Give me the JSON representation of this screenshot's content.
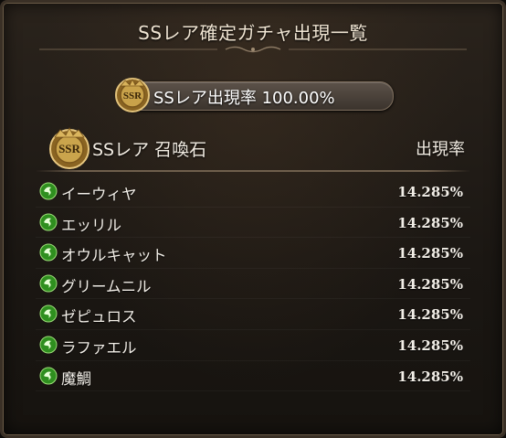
{
  "dialog": {
    "title": "SSレア確定ガチャ出現一覧"
  },
  "banner": {
    "badge_text": "SSR",
    "rate_text": "SSレア出現率 100.00%"
  },
  "header": {
    "badge_text": "SSR",
    "label": "SSレア 召喚石",
    "rate_label": "出現率"
  },
  "colors": {
    "gold": "#c9a24a",
    "wind_icon": "#3fae2a",
    "text": "#f3efe8"
  },
  "items": [
    {
      "name": "イーウィヤ",
      "rate": "14.285%",
      "icon": "wind-element-icon"
    },
    {
      "name": "エッリル",
      "rate": "14.285%",
      "icon": "wind-element-icon"
    },
    {
      "name": "オウルキャット",
      "rate": "14.285%",
      "icon": "wind-element-icon"
    },
    {
      "name": "グリームニル",
      "rate": "14.285%",
      "icon": "wind-element-icon"
    },
    {
      "name": "ゼピュロス",
      "rate": "14.285%",
      "icon": "wind-element-icon"
    },
    {
      "name": "ラファエル",
      "rate": "14.285%",
      "icon": "wind-element-icon"
    },
    {
      "name": "魔鯛",
      "rate": "14.285%",
      "icon": "wind-element-icon"
    }
  ]
}
